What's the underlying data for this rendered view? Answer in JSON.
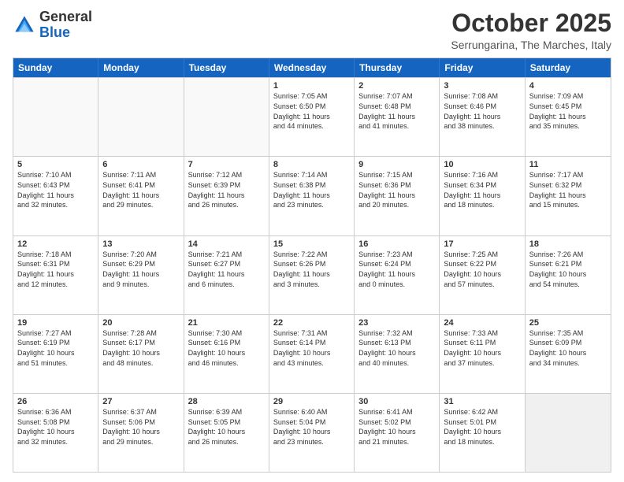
{
  "header": {
    "logo_general": "General",
    "logo_blue": "Blue",
    "month_title": "October 2025",
    "subtitle": "Serrungarina, The Marches, Italy"
  },
  "days_of_week": [
    "Sunday",
    "Monday",
    "Tuesday",
    "Wednesday",
    "Thursday",
    "Friday",
    "Saturday"
  ],
  "weeks": [
    [
      {
        "day": "",
        "lines": [],
        "empty": true
      },
      {
        "day": "",
        "lines": [],
        "empty": true
      },
      {
        "day": "",
        "lines": [],
        "empty": true
      },
      {
        "day": "1",
        "lines": [
          "Sunrise: 7:05 AM",
          "Sunset: 6:50 PM",
          "Daylight: 11 hours",
          "and 44 minutes."
        ]
      },
      {
        "day": "2",
        "lines": [
          "Sunrise: 7:07 AM",
          "Sunset: 6:48 PM",
          "Daylight: 11 hours",
          "and 41 minutes."
        ]
      },
      {
        "day": "3",
        "lines": [
          "Sunrise: 7:08 AM",
          "Sunset: 6:46 PM",
          "Daylight: 11 hours",
          "and 38 minutes."
        ]
      },
      {
        "day": "4",
        "lines": [
          "Sunrise: 7:09 AM",
          "Sunset: 6:45 PM",
          "Daylight: 11 hours",
          "and 35 minutes."
        ]
      }
    ],
    [
      {
        "day": "5",
        "lines": [
          "Sunrise: 7:10 AM",
          "Sunset: 6:43 PM",
          "Daylight: 11 hours",
          "and 32 minutes."
        ]
      },
      {
        "day": "6",
        "lines": [
          "Sunrise: 7:11 AM",
          "Sunset: 6:41 PM",
          "Daylight: 11 hours",
          "and 29 minutes."
        ]
      },
      {
        "day": "7",
        "lines": [
          "Sunrise: 7:12 AM",
          "Sunset: 6:39 PM",
          "Daylight: 11 hours",
          "and 26 minutes."
        ]
      },
      {
        "day": "8",
        "lines": [
          "Sunrise: 7:14 AM",
          "Sunset: 6:38 PM",
          "Daylight: 11 hours",
          "and 23 minutes."
        ]
      },
      {
        "day": "9",
        "lines": [
          "Sunrise: 7:15 AM",
          "Sunset: 6:36 PM",
          "Daylight: 11 hours",
          "and 20 minutes."
        ]
      },
      {
        "day": "10",
        "lines": [
          "Sunrise: 7:16 AM",
          "Sunset: 6:34 PM",
          "Daylight: 11 hours",
          "and 18 minutes."
        ]
      },
      {
        "day": "11",
        "lines": [
          "Sunrise: 7:17 AM",
          "Sunset: 6:32 PM",
          "Daylight: 11 hours",
          "and 15 minutes."
        ]
      }
    ],
    [
      {
        "day": "12",
        "lines": [
          "Sunrise: 7:18 AM",
          "Sunset: 6:31 PM",
          "Daylight: 11 hours",
          "and 12 minutes."
        ]
      },
      {
        "day": "13",
        "lines": [
          "Sunrise: 7:20 AM",
          "Sunset: 6:29 PM",
          "Daylight: 11 hours",
          "and 9 minutes."
        ]
      },
      {
        "day": "14",
        "lines": [
          "Sunrise: 7:21 AM",
          "Sunset: 6:27 PM",
          "Daylight: 11 hours",
          "and 6 minutes."
        ]
      },
      {
        "day": "15",
        "lines": [
          "Sunrise: 7:22 AM",
          "Sunset: 6:26 PM",
          "Daylight: 11 hours",
          "and 3 minutes."
        ]
      },
      {
        "day": "16",
        "lines": [
          "Sunrise: 7:23 AM",
          "Sunset: 6:24 PM",
          "Daylight: 11 hours",
          "and 0 minutes."
        ]
      },
      {
        "day": "17",
        "lines": [
          "Sunrise: 7:25 AM",
          "Sunset: 6:22 PM",
          "Daylight: 10 hours",
          "and 57 minutes."
        ]
      },
      {
        "day": "18",
        "lines": [
          "Sunrise: 7:26 AM",
          "Sunset: 6:21 PM",
          "Daylight: 10 hours",
          "and 54 minutes."
        ]
      }
    ],
    [
      {
        "day": "19",
        "lines": [
          "Sunrise: 7:27 AM",
          "Sunset: 6:19 PM",
          "Daylight: 10 hours",
          "and 51 minutes."
        ]
      },
      {
        "day": "20",
        "lines": [
          "Sunrise: 7:28 AM",
          "Sunset: 6:17 PM",
          "Daylight: 10 hours",
          "and 48 minutes."
        ]
      },
      {
        "day": "21",
        "lines": [
          "Sunrise: 7:30 AM",
          "Sunset: 6:16 PM",
          "Daylight: 10 hours",
          "and 46 minutes."
        ]
      },
      {
        "day": "22",
        "lines": [
          "Sunrise: 7:31 AM",
          "Sunset: 6:14 PM",
          "Daylight: 10 hours",
          "and 43 minutes."
        ]
      },
      {
        "day": "23",
        "lines": [
          "Sunrise: 7:32 AM",
          "Sunset: 6:13 PM",
          "Daylight: 10 hours",
          "and 40 minutes."
        ]
      },
      {
        "day": "24",
        "lines": [
          "Sunrise: 7:33 AM",
          "Sunset: 6:11 PM",
          "Daylight: 10 hours",
          "and 37 minutes."
        ]
      },
      {
        "day": "25",
        "lines": [
          "Sunrise: 7:35 AM",
          "Sunset: 6:09 PM",
          "Daylight: 10 hours",
          "and 34 minutes."
        ]
      }
    ],
    [
      {
        "day": "26",
        "lines": [
          "Sunrise: 6:36 AM",
          "Sunset: 5:08 PM",
          "Daylight: 10 hours",
          "and 32 minutes."
        ]
      },
      {
        "day": "27",
        "lines": [
          "Sunrise: 6:37 AM",
          "Sunset: 5:06 PM",
          "Daylight: 10 hours",
          "and 29 minutes."
        ]
      },
      {
        "day": "28",
        "lines": [
          "Sunrise: 6:39 AM",
          "Sunset: 5:05 PM",
          "Daylight: 10 hours",
          "and 26 minutes."
        ]
      },
      {
        "day": "29",
        "lines": [
          "Sunrise: 6:40 AM",
          "Sunset: 5:04 PM",
          "Daylight: 10 hours",
          "and 23 minutes."
        ]
      },
      {
        "day": "30",
        "lines": [
          "Sunrise: 6:41 AM",
          "Sunset: 5:02 PM",
          "Daylight: 10 hours",
          "and 21 minutes."
        ]
      },
      {
        "day": "31",
        "lines": [
          "Sunrise: 6:42 AM",
          "Sunset: 5:01 PM",
          "Daylight: 10 hours",
          "and 18 minutes."
        ]
      },
      {
        "day": "",
        "lines": [],
        "empty": true,
        "shaded": true
      }
    ]
  ]
}
